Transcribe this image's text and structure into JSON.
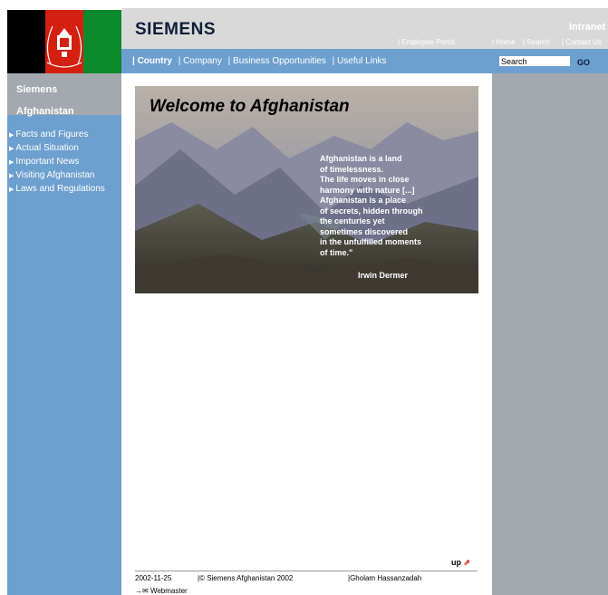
{
  "brand": {
    "logo": "SIEMENS",
    "section": "Intranet"
  },
  "toplinks": {
    "employee_portal": "| Employee Portal",
    "home": "| Home",
    "search": "| Search",
    "contact": "| Contact Us"
  },
  "sidebar": {
    "title_line1": "Siemens",
    "title_line2": "Afghanistan",
    "items": [
      {
        "label": "Facts and Figures"
      },
      {
        "label": "Actual Situation"
      },
      {
        "label": "Important News"
      },
      {
        "label": "Visiting Afghanistan"
      },
      {
        "label": "Laws and Regulations"
      }
    ]
  },
  "nav": {
    "items": [
      {
        "label": "| Country"
      },
      {
        "label": "| Company"
      },
      {
        "label": "| Business Opportunities"
      },
      {
        "label": "| Useful Links"
      }
    ]
  },
  "search": {
    "value": "Search",
    "go": "GO"
  },
  "hero": {
    "title": "Welcome to Afghanistan",
    "quote": [
      "Afghanistan is a land",
      "of timelessness.",
      "The life moves in close",
      "harmony with nature [...]",
      "Afghanistan is a place",
      "of secrets, hidden through",
      "the centuries yet",
      "sometimes discovered",
      "in the unfulfilled moments",
      "of time.\""
    ],
    "author": "Irwin Dermer"
  },
  "footer": {
    "up": "up",
    "date": "2002-11-25",
    "copyright": "|© Siemens Afghanistan 2002",
    "name": "|Gholam Hassanzadah",
    "webmaster": "Webmaster"
  },
  "colors": {
    "sidebar": "#6d9fcf",
    "header": "#d9d9d9",
    "rightcol": "#a3a9ae"
  }
}
